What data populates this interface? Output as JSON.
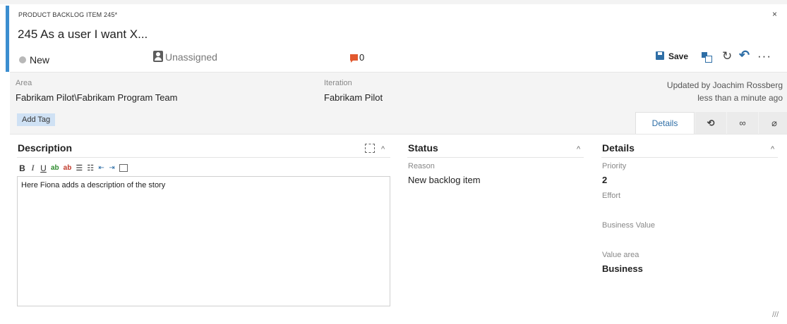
{
  "header": {
    "item_type": "PRODUCT BACKLOG ITEM 245*",
    "close_glyph": "×",
    "title": "245  As a user I want X...",
    "accent_color": "#3b8ed0",
    "state": "New",
    "state_color": "#b8b8b8",
    "assigned": "Unassigned",
    "discussion_count": "0",
    "discussion_color": "#e2582e"
  },
  "toolbar": {
    "save_label": "Save",
    "icons": [
      "save-icon",
      "copy-icon",
      "refresh-icon",
      "undo-icon",
      "more-icon"
    ],
    "refresh_glyph": "↻",
    "undo_glyph": "↶",
    "more_glyph": "···"
  },
  "fields": {
    "area_label": "Area",
    "area_value": "Fabrikam Pilot\\Fabrikam Program Team",
    "iteration_label": "Iteration",
    "iteration_value": "Fabrikam Pilot",
    "updated_by": "Updated by Joachim Rossberg",
    "updated_when": "less than a minute ago",
    "add_tag": "Add Tag"
  },
  "tabs": [
    {
      "label": "Details",
      "active": true
    },
    {
      "label": "history-icon",
      "glyph": "⟲"
    },
    {
      "label": "links-icon",
      "glyph": "∞"
    },
    {
      "label": "attachments-icon",
      "glyph": "⌀"
    }
  ],
  "description": {
    "title": "Description",
    "toolbar": {
      "bold": "B",
      "italic": "I",
      "underline": "U",
      "highlight": "ab",
      "font_color": "ab",
      "bullets": "☰",
      "numbers": "☷",
      "indent_dec": "⇤",
      "indent_inc": "⇥"
    },
    "text": "Here Fiona adds a description of the story"
  },
  "status": {
    "title": "Status",
    "reason_label": "Reason",
    "reason_value": "New backlog item"
  },
  "details": {
    "title": "Details",
    "priority_label": "Priority",
    "priority_value": "2",
    "effort_label": "Effort",
    "effort_value": "",
    "business_value_label": "Business Value",
    "business_value_value": "",
    "value_area_label": "Value area",
    "value_area_value": "Business"
  },
  "chevron_glyph": "^",
  "resize_glyph": "///"
}
